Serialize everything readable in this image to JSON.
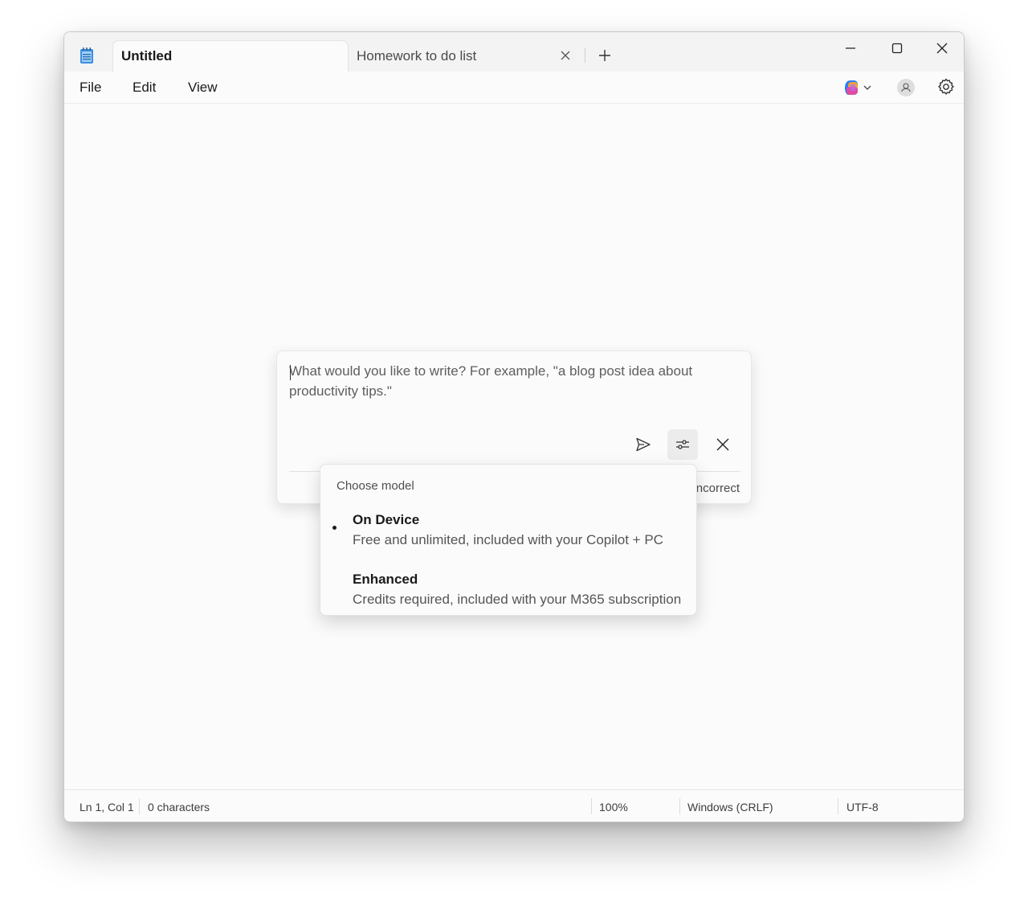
{
  "tabs": [
    {
      "label": "Untitled",
      "active": true
    },
    {
      "label": "Homework to do list",
      "active": false
    }
  ],
  "menu": {
    "file": "File",
    "edit": "Edit",
    "view": "View"
  },
  "prompt": {
    "placeholder": "What would you like to write? For example, \"a blog post idea about productivity tips.\"",
    "footer_text": "Incorrect"
  },
  "model_menu": {
    "header": "Choose model",
    "options": [
      {
        "title": "On Device",
        "description": "Free and unlimited, included with your Copilot + PC",
        "selected": true
      },
      {
        "title": "Enhanced",
        "description": "Credits required, included with your M365 subscription",
        "selected": false
      }
    ]
  },
  "status": {
    "position": "Ln 1, Col 1",
    "characters": "0 characters",
    "zoom": "100%",
    "line_endings": "Windows (CRLF)",
    "encoding": "UTF-8"
  },
  "icons": {
    "app": "notepad-icon",
    "tab_close": "close-icon",
    "new_tab": "plus-icon",
    "minimize": "minimize-icon",
    "maximize": "maximize-icon",
    "close": "close-icon",
    "copilot": "copilot-icon",
    "account": "account-icon",
    "settings": "gear-icon",
    "send": "send-icon",
    "model_options": "sliders-icon",
    "dismiss": "close-icon"
  },
  "colors": {
    "notepad_blue": "#3d8ee0",
    "window_bg": "#fbfbfb",
    "titlebar_bg": "#f3f3f3"
  }
}
